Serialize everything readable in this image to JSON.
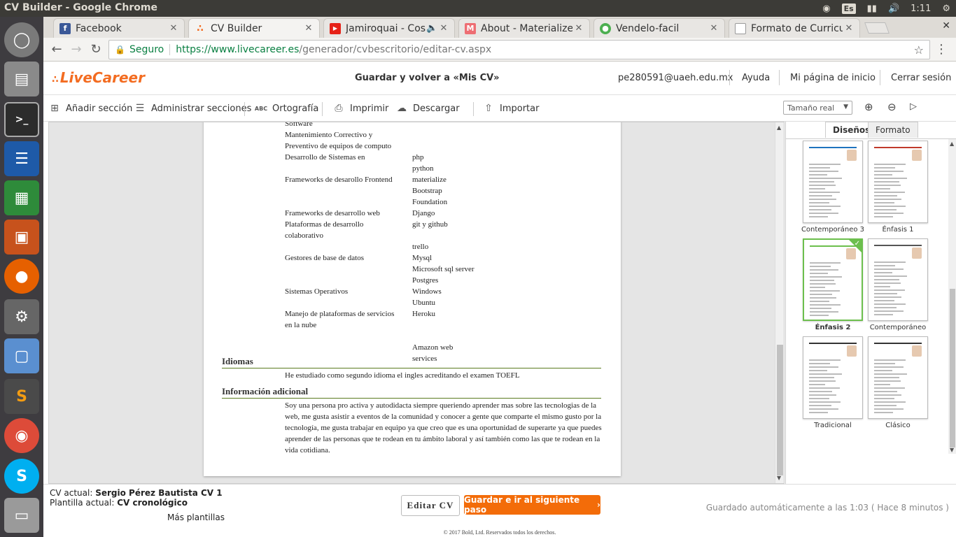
{
  "os": {
    "window_title": "CV Builder - Google Chrome",
    "keyboard_layout": "Es",
    "clock": "1:11",
    "launcher_icons": [
      "ubuntu-dash-icon",
      "files-icon",
      "terminal-icon",
      "writer-icon",
      "calc-icon",
      "impress-icon",
      "firefox-icon",
      "settings-icon",
      "virtualbox-icon",
      "sublime-icon",
      "chrome-icon",
      "skype-icon",
      "trash-icon"
    ]
  },
  "browser": {
    "tabs": [
      {
        "label": "Facebook",
        "icon": "facebook-icon",
        "color": "#3b5998"
      },
      {
        "label": "CV Builder",
        "icon": "livecareer-icon",
        "color": "#f36c21"
      },
      {
        "label": "Jamiroquai - Cos",
        "icon": "youtube-icon",
        "color": "#e62117"
      },
      {
        "label": "About - Materialize",
        "icon": "materialize-icon",
        "color": "#ee6e73"
      },
      {
        "label": "Vendelo-facil",
        "icon": "globe-icon",
        "color": "#4caf50"
      },
      {
        "label": "Formato de Curricu",
        "icon": "document-icon",
        "color": "#999999"
      }
    ],
    "secure_label": "Seguro",
    "url_main": "https://www.livecareer.es",
    "url_path": "/generador/cvbescritorio/editar-cv.aspx"
  },
  "header": {
    "logo": "LiveCareer",
    "save_return": "Guardar y volver a «Mis CV»",
    "email": "pe280591@uaeh.edu.mx",
    "help": "Ayuda",
    "home": "Mi página de inicio",
    "logout": "Cerrar sesión"
  },
  "toolbar": {
    "add_section": "Añadir sección",
    "manage_sections": "Administrar secciones",
    "spelling": "Ortografía",
    "print": "Imprimir",
    "download": "Descargar",
    "import": "Importar",
    "zoom_select": "Tamaño real"
  },
  "cv": {
    "skill_rows": [
      {
        "left": "Software",
        "right": ""
      },
      {
        "left": "Mantenimiento Correctivo y",
        "right": ""
      },
      {
        "left": "Preventivo de equipos de computo",
        "right": ""
      },
      {
        "left": "Desarrollo de Sistemas en",
        "right": "php"
      },
      {
        "left": "",
        "right": "python"
      },
      {
        "left": "Frameworks de desarollo Frontend",
        "right": "materialize"
      },
      {
        "left": "",
        "right": "Bootstrap"
      },
      {
        "left": "",
        "right": "Foundation"
      },
      {
        "left": "Frameworks de desarrollo web",
        "right": "Django"
      },
      {
        "left": "Plataformas de desarrollo",
        "right": "git y github"
      },
      {
        "left": "colaborativo",
        "right": ""
      },
      {
        "left": "",
        "right": "trello"
      },
      {
        "left": "Gestores de base de datos",
        "right": "Mysql"
      },
      {
        "left": "",
        "right": "Microsoft sql server"
      },
      {
        "left": "",
        "right": "Postgres"
      },
      {
        "left": "Sistemas Operativos",
        "right": "Windows"
      },
      {
        "left": "",
        "right": "Ubuntu"
      },
      {
        "left": "Manejo de plataformas de servicios",
        "right": "Heroku"
      },
      {
        "left": "en la nube",
        "right": ""
      },
      {
        "left": "",
        "right": ""
      },
      {
        "left": "",
        "right": "Amazon web"
      },
      {
        "left": "",
        "right": "services"
      }
    ],
    "languages_title": "Idiomas",
    "languages_text": "He estudiado como segundo idioma el ingles acreditando el examen TOEFL",
    "additional_title": "Información adicional",
    "additional_text": "Soy una persona pro activa y autodidacta siempre queriendo aprender mas sobre las tecnologias de la web, me gusta asistir a eventos de la comunidad y conocer a gente que comparte el mismo gusto por la tecnología, me gusta trabajar en equipo ya que creo que es una oportunidad de superarte ya que puedes aprender de las personas que te rodean en tu ámbito laboral y así también como las que te rodean en la vida cotidiana."
  },
  "side": {
    "tab_designs": "Diseños",
    "tab_format": "Formato",
    "templates": [
      {
        "label": "Contemporáneo 3",
        "accent": "#1e73be",
        "selected": false
      },
      {
        "label": "Énfasis 1",
        "accent": "#c0392b",
        "selected": false
      },
      {
        "label": "Énfasis 2",
        "accent": "#6cbf4d",
        "selected": true
      },
      {
        "label": "Contemporáneo",
        "accent": "#555555",
        "selected": false
      },
      {
        "label": "Tradicional",
        "accent": "#333333",
        "selected": false
      },
      {
        "label": "Clásico",
        "accent": "#333333",
        "selected": false
      }
    ]
  },
  "footer": {
    "cv_label": "CV actual:",
    "cv_name": "Sergio Pérez Bautista CV 1",
    "template_label": "Plantilla actual:",
    "template_name": "CV cronológico",
    "more_templates": "Más plantillas",
    "edit_button": "Editar CV",
    "save_button": "Guardar e ir al siguiente paso",
    "autosave": "Guardado automáticamente a las  1:03 (  Hace 8 minutos )",
    "copyright": "© 2017 Bold, Ltd. Reservados todos los derechos."
  },
  "colors": {
    "accent": "#f36c21",
    "save_button": "#f36c09",
    "section_line": "#5a7b1f",
    "selected_template": "#6cbf4d"
  }
}
